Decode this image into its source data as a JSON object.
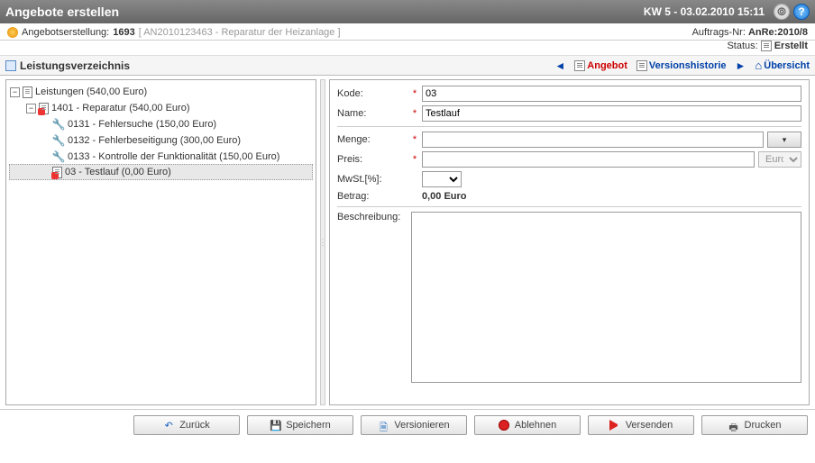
{
  "titlebar": {
    "title": "Angebote erstellen",
    "datetime": "KW 5 - 03.02.2010 15:11"
  },
  "context": {
    "label": "Angebotserstellung:",
    "order_id": "1693",
    "reference": "[ AN2010123463 - Reparatur der Heizanlage ]",
    "auftrag_label": "Auftrags-Nr:",
    "auftrag_value": "AnRe:2010/8",
    "status_label": "Status:",
    "status_value": "Erstellt"
  },
  "section": {
    "title": "Leistungsverzeichnis",
    "links": {
      "angebot": "Angebot",
      "version": "Versionshistorie",
      "uebersicht": "Übersicht"
    }
  },
  "tree": {
    "root": "Leistungen (540,00 Euro)",
    "group": "1401 - Reparatur (540,00 Euro)",
    "items": [
      "0131 - Fehlersuche (150,00 Euro)",
      "0132 - Fehlerbeseitigung (300,00 Euro)",
      "0133 - Kontrolle der Funktionalität (150,00 Euro)"
    ],
    "selected": "03 - Testlauf (0,00 Euro)"
  },
  "form": {
    "kode_label": "Kode:",
    "kode_value": "03",
    "name_label": "Name:",
    "name_value": "Testlauf",
    "menge_label": "Menge:",
    "menge_value": "",
    "preis_label": "Preis:",
    "preis_value": "",
    "preis_unit": "Euro",
    "mwst_label": "MwSt.[%]:",
    "mwst_value": "",
    "betrag_label": "Betrag:",
    "betrag_value": "0,00 Euro",
    "beschreibung_label": "Beschreibung:",
    "beschreibung_value": ""
  },
  "buttons": {
    "back": "Zurück",
    "save": "Speichern",
    "version": "Versionieren",
    "deny": "Ablehnen",
    "send": "Versenden",
    "print": "Drucken"
  }
}
